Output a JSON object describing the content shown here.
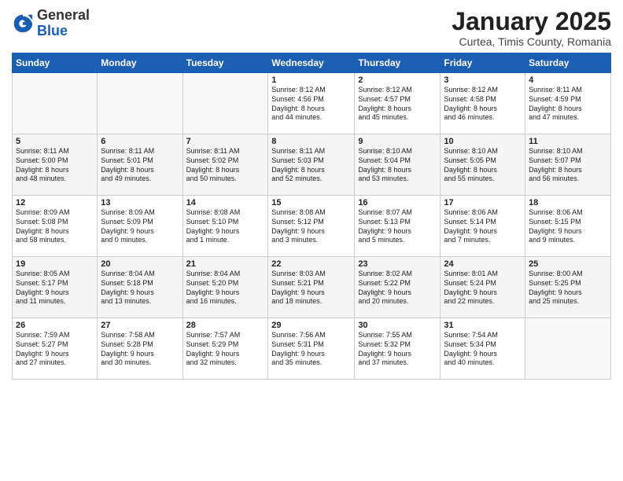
{
  "header": {
    "logo_general": "General",
    "logo_blue": "Blue",
    "title": "January 2025",
    "subtitle": "Curtea, Timis County, Romania"
  },
  "days_of_week": [
    "Sunday",
    "Monday",
    "Tuesday",
    "Wednesday",
    "Thursday",
    "Friday",
    "Saturday"
  ],
  "weeks": [
    [
      {
        "day": "",
        "text": ""
      },
      {
        "day": "",
        "text": ""
      },
      {
        "day": "",
        "text": ""
      },
      {
        "day": "1",
        "text": "Sunrise: 8:12 AM\nSunset: 4:56 PM\nDaylight: 8 hours\nand 44 minutes."
      },
      {
        "day": "2",
        "text": "Sunrise: 8:12 AM\nSunset: 4:57 PM\nDaylight: 8 hours\nand 45 minutes."
      },
      {
        "day": "3",
        "text": "Sunrise: 8:12 AM\nSunset: 4:58 PM\nDaylight: 8 hours\nand 46 minutes."
      },
      {
        "day": "4",
        "text": "Sunrise: 8:11 AM\nSunset: 4:59 PM\nDaylight: 8 hours\nand 47 minutes."
      }
    ],
    [
      {
        "day": "5",
        "text": "Sunrise: 8:11 AM\nSunset: 5:00 PM\nDaylight: 8 hours\nand 48 minutes."
      },
      {
        "day": "6",
        "text": "Sunrise: 8:11 AM\nSunset: 5:01 PM\nDaylight: 8 hours\nand 49 minutes."
      },
      {
        "day": "7",
        "text": "Sunrise: 8:11 AM\nSunset: 5:02 PM\nDaylight: 8 hours\nand 50 minutes."
      },
      {
        "day": "8",
        "text": "Sunrise: 8:11 AM\nSunset: 5:03 PM\nDaylight: 8 hours\nand 52 minutes."
      },
      {
        "day": "9",
        "text": "Sunrise: 8:10 AM\nSunset: 5:04 PM\nDaylight: 8 hours\nand 53 minutes."
      },
      {
        "day": "10",
        "text": "Sunrise: 8:10 AM\nSunset: 5:05 PM\nDaylight: 8 hours\nand 55 minutes."
      },
      {
        "day": "11",
        "text": "Sunrise: 8:10 AM\nSunset: 5:07 PM\nDaylight: 8 hours\nand 56 minutes."
      }
    ],
    [
      {
        "day": "12",
        "text": "Sunrise: 8:09 AM\nSunset: 5:08 PM\nDaylight: 8 hours\nand 58 minutes."
      },
      {
        "day": "13",
        "text": "Sunrise: 8:09 AM\nSunset: 5:09 PM\nDaylight: 9 hours\nand 0 minutes."
      },
      {
        "day": "14",
        "text": "Sunrise: 8:08 AM\nSunset: 5:10 PM\nDaylight: 9 hours\nand 1 minute."
      },
      {
        "day": "15",
        "text": "Sunrise: 8:08 AM\nSunset: 5:12 PM\nDaylight: 9 hours\nand 3 minutes."
      },
      {
        "day": "16",
        "text": "Sunrise: 8:07 AM\nSunset: 5:13 PM\nDaylight: 9 hours\nand 5 minutes."
      },
      {
        "day": "17",
        "text": "Sunrise: 8:06 AM\nSunset: 5:14 PM\nDaylight: 9 hours\nand 7 minutes."
      },
      {
        "day": "18",
        "text": "Sunrise: 8:06 AM\nSunset: 5:15 PM\nDaylight: 9 hours\nand 9 minutes."
      }
    ],
    [
      {
        "day": "19",
        "text": "Sunrise: 8:05 AM\nSunset: 5:17 PM\nDaylight: 9 hours\nand 11 minutes."
      },
      {
        "day": "20",
        "text": "Sunrise: 8:04 AM\nSunset: 5:18 PM\nDaylight: 9 hours\nand 13 minutes."
      },
      {
        "day": "21",
        "text": "Sunrise: 8:04 AM\nSunset: 5:20 PM\nDaylight: 9 hours\nand 16 minutes."
      },
      {
        "day": "22",
        "text": "Sunrise: 8:03 AM\nSunset: 5:21 PM\nDaylight: 9 hours\nand 18 minutes."
      },
      {
        "day": "23",
        "text": "Sunrise: 8:02 AM\nSunset: 5:22 PM\nDaylight: 9 hours\nand 20 minutes."
      },
      {
        "day": "24",
        "text": "Sunrise: 8:01 AM\nSunset: 5:24 PM\nDaylight: 9 hours\nand 22 minutes."
      },
      {
        "day": "25",
        "text": "Sunrise: 8:00 AM\nSunset: 5:25 PM\nDaylight: 9 hours\nand 25 minutes."
      }
    ],
    [
      {
        "day": "26",
        "text": "Sunrise: 7:59 AM\nSunset: 5:27 PM\nDaylight: 9 hours\nand 27 minutes."
      },
      {
        "day": "27",
        "text": "Sunrise: 7:58 AM\nSunset: 5:28 PM\nDaylight: 9 hours\nand 30 minutes."
      },
      {
        "day": "28",
        "text": "Sunrise: 7:57 AM\nSunset: 5:29 PM\nDaylight: 9 hours\nand 32 minutes."
      },
      {
        "day": "29",
        "text": "Sunrise: 7:56 AM\nSunset: 5:31 PM\nDaylight: 9 hours\nand 35 minutes."
      },
      {
        "day": "30",
        "text": "Sunrise: 7:55 AM\nSunset: 5:32 PM\nDaylight: 9 hours\nand 37 minutes."
      },
      {
        "day": "31",
        "text": "Sunrise: 7:54 AM\nSunset: 5:34 PM\nDaylight: 9 hours\nand 40 minutes."
      },
      {
        "day": "",
        "text": ""
      }
    ]
  ]
}
